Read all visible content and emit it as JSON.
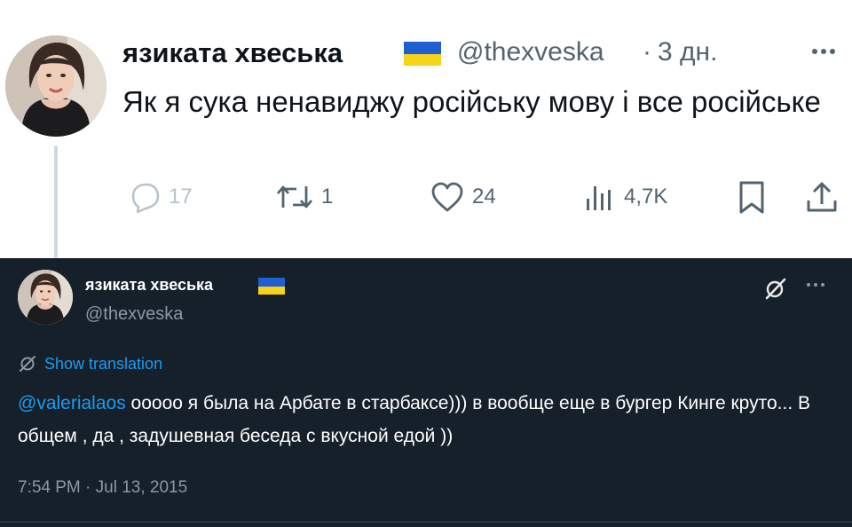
{
  "top_tweet": {
    "display_name": "язиката хвеська",
    "handle": "@thexveska",
    "separator": "·",
    "time": "3 дн.",
    "text": "Як я сука ненавиджу російську мову і все російське",
    "flag_icon": "ukraine-flag-icon",
    "actions": {
      "reply": {
        "icon": "reply-icon",
        "count": "17"
      },
      "retweet": {
        "icon": "retweet-icon",
        "count": "1"
      },
      "like": {
        "icon": "heart-icon",
        "count": "24"
      },
      "views": {
        "icon": "views-chart-icon",
        "count": "4,7K"
      },
      "bookmark": {
        "icon": "bookmark-icon"
      },
      "share": {
        "icon": "share-icon"
      }
    }
  },
  "quoted_tweet": {
    "display_name": "язиката хвеська",
    "handle": "@thexveska",
    "flag_icon": "ukraine-flag-icon",
    "translate_label": "Show translation",
    "mention": "@valerialaos",
    "text": " ооооо я была на Арбате в старбаксе))) в вообще еще в бургер Кинге круто... В общем , да , задушевная беседа с вкусной едой ))",
    "timestamp": "7:54 PM · Jul 13, 2015"
  },
  "colors": {
    "accent": "#1d9bf0",
    "dark_bg": "#15202b",
    "muted_text": "#536471",
    "flag_blue": "#1f5fd0",
    "flag_yellow": "#f7d31a"
  }
}
